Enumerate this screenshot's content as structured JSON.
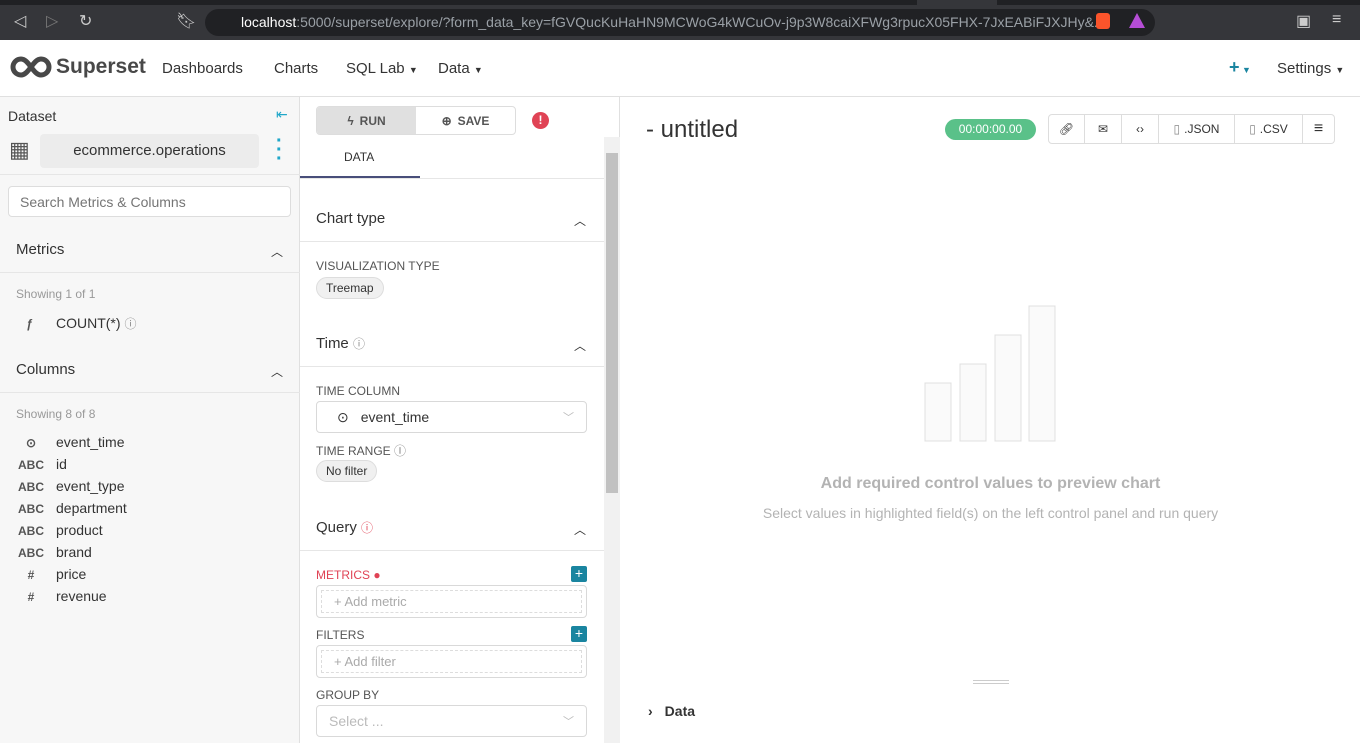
{
  "browser": {
    "url_host": "localhost",
    "url_rest": ":5000/superset/explore/?form_data_key=fGVQucKuHaHN9MCWoG4kWCuOv-j9p3W8caiXFWg3rpucX05FHX-7JxEABiFJXJHy&..."
  },
  "nav": {
    "brand": "Superset",
    "items": [
      "Dashboards",
      "Charts",
      "SQL Lab",
      "Data"
    ],
    "plus": "+",
    "settings": "Settings"
  },
  "dataset": {
    "label": "Dataset",
    "name": "ecommerce.operations",
    "search_placeholder": "Search Metrics & Columns",
    "metrics_title": "Metrics",
    "metrics_showing": "Showing 1 of 1",
    "metrics": [
      {
        "icon": "ƒ",
        "name": "COUNT(*)"
      }
    ],
    "columns_title": "Columns",
    "columns_showing": "Showing 8 of 8",
    "columns": [
      {
        "type": "⊙",
        "name": "event_time"
      },
      {
        "type": "ABC",
        "name": "id"
      },
      {
        "type": "ABC",
        "name": "event_type"
      },
      {
        "type": "ABC",
        "name": "department"
      },
      {
        "type": "ABC",
        "name": "product"
      },
      {
        "type": "ABC",
        "name": "brand"
      },
      {
        "type": "#",
        "name": "price"
      },
      {
        "type": "#",
        "name": "revenue"
      }
    ]
  },
  "controls": {
    "run": "RUN",
    "save": "SAVE",
    "tab": "DATA",
    "chart_type": "Chart type",
    "viz_label": "VISUALIZATION TYPE",
    "viz_value": "Treemap",
    "time": "Time",
    "time_column_label": "TIME COLUMN",
    "time_column_value": "event_time",
    "time_range_label": "TIME RANGE",
    "time_range_value": "No filter",
    "query": "Query",
    "metrics_label": "METRICS",
    "add_metric": "Add metric",
    "filters_label": "FILTERS",
    "add_filter": "Add filter",
    "group_by_label": "GROUP BY",
    "group_by_placeholder": "Select ..."
  },
  "chart": {
    "title": "- untitled",
    "timer": "00:00:00.00",
    "json": ".JSON",
    "csv": ".CSV",
    "empty_title": "Add required control values to preview chart",
    "empty_sub": "Select values in highlighted field(s) on the left control panel and run query",
    "data_section": "Data"
  },
  "colors": {
    "accent": "#20a7c9",
    "error": "#e04355",
    "timer": "#5ac189",
    "tab_underline": "#484e7a"
  }
}
